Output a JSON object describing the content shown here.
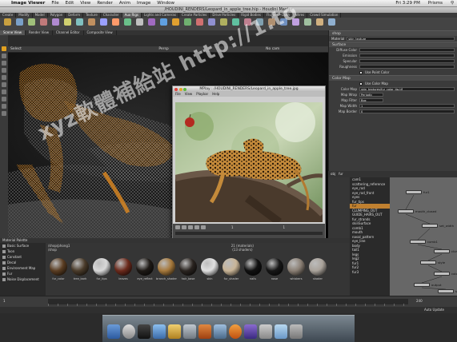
{
  "menubar": {
    "app_name": "Image Viewer",
    "items": [
      "File",
      "Edit",
      "View",
      "Render",
      "Anim",
      "Image",
      "Window"
    ],
    "clock": "Fri 3:29 PM",
    "user": "Prisms"
  },
  "window": {
    "title": "/HOUDINI_RENDERS/Leopard_in_apple_tree.hip - Houdini Master"
  },
  "shelf_tabs": [
    "Create",
    "Modify",
    "Model",
    "Polygon",
    "Deform",
    "Texture",
    "Character",
    "Aux Rigs",
    "Lights and Cameras",
    "Create Particles",
    "Drive Particles",
    "Rigid Bodies",
    "Fluids",
    "Cloth",
    "Wires",
    "Crowd Simulation"
  ],
  "panel_tabs": [
    "Scene View",
    "Render View",
    "Channel Editor",
    "Composite View"
  ],
  "viewport": {
    "label": "Select",
    "view": "Persp",
    "camera": "No cam"
  },
  "mplay": {
    "title": "MPlay : /HOUDINI_RENDERS/Leopard_in_apple_tree.jpg",
    "menu": [
      "File",
      "View",
      "Playbar",
      "Help"
    ],
    "frame": "1",
    "end_frame": "1"
  },
  "right_panel": {
    "header": "shop",
    "node_type": "Material",
    "node_name": "skin_texture",
    "section_surface": "Surface",
    "rows": [
      {
        "label": "Diffuse Color",
        "value": ""
      },
      {
        "label": "Emission",
        "value": ""
      },
      {
        "label": "Specular",
        "value": ""
      },
      {
        "label": "Roughness",
        "value": ""
      }
    ],
    "use_point_color": "Use Point Color",
    "section_color_map": "Color Map",
    "use_color_map": "Use Color Map",
    "color_map_label": "Color Map",
    "color_map_value": "skin_textures/fur_color_tip.tif",
    "map_wrap_label": "Map Wrap",
    "map_wrap_value": "Periodic",
    "map_filter_label": "Map Filter",
    "map_filter_value": "Box",
    "map_width_label": "Map Width",
    "map_width_value": "1",
    "map_border_label": "Map Border",
    "map_border_value": "0"
  },
  "network": {
    "tabs": [
      "obj",
      "fur"
    ],
    "node_list": [
      "cam1",
      "scattering_reference",
      "eye_rod",
      "eye_rod_front",
      "eyes",
      "fur_tips",
      "fur",
      "CLUMPING_OUT",
      "GUIDE_HAIRS_OUT",
      "fur_strands",
      "skinSurface",
      "comb1",
      "mouth",
      "nasal_pattern",
      "eye_line",
      "body",
      "tail1",
      "legs",
      "leg2",
      "fur1",
      "fur2",
      "fur3"
    ],
    "selected": "fur",
    "nodes": [
      "fur1",
      "mouth_closed",
      "set_width",
      "comb1",
      "clump",
      "style",
      "color",
      "output",
      "skin_out"
    ]
  },
  "materials": {
    "palette_tab": "Material Palette",
    "tree": [
      "Basic Surface",
      "Toon",
      "Constant",
      "Decal",
      "Environment Map",
      "Fur",
      "Noise Displacement"
    ],
    "path": "/shop/phong1",
    "sub": "/shop",
    "count_left": "21 (materials)",
    "count_right": "(13 shaders)",
    "balls": [
      {
        "name": "fur_color",
        "color": "#5a3d22"
      },
      {
        "name": "tree_bark",
        "color": "#4a3b2a"
      },
      {
        "name": "fur_tips",
        "color": "#d8d8d8"
      },
      {
        "name": "leaves",
        "color": "#6b2a1c"
      },
      {
        "name": "eye_reflect",
        "color": "#1e1a16"
      },
      {
        "name": "branch_shader",
        "color": "#a6793c"
      },
      {
        "name": "hair_base",
        "color": "#2a2420"
      },
      {
        "name": "skin",
        "color": "#e0e0e0"
      },
      {
        "name": "fur_shader",
        "color": "#c9b597"
      },
      {
        "name": "nails",
        "color": "#111111"
      },
      {
        "name": "nose",
        "color": "#171717"
      },
      {
        "name": "whiskers",
        "color": "#8a7f74"
      },
      {
        "name": "shader",
        "color": "#a9a29a"
      }
    ]
  },
  "timeline": {
    "start": "1",
    "end": "240"
  },
  "status": {
    "text": "Auto Update"
  },
  "watermark": "xyz軟體補給站 http://1.to"
}
